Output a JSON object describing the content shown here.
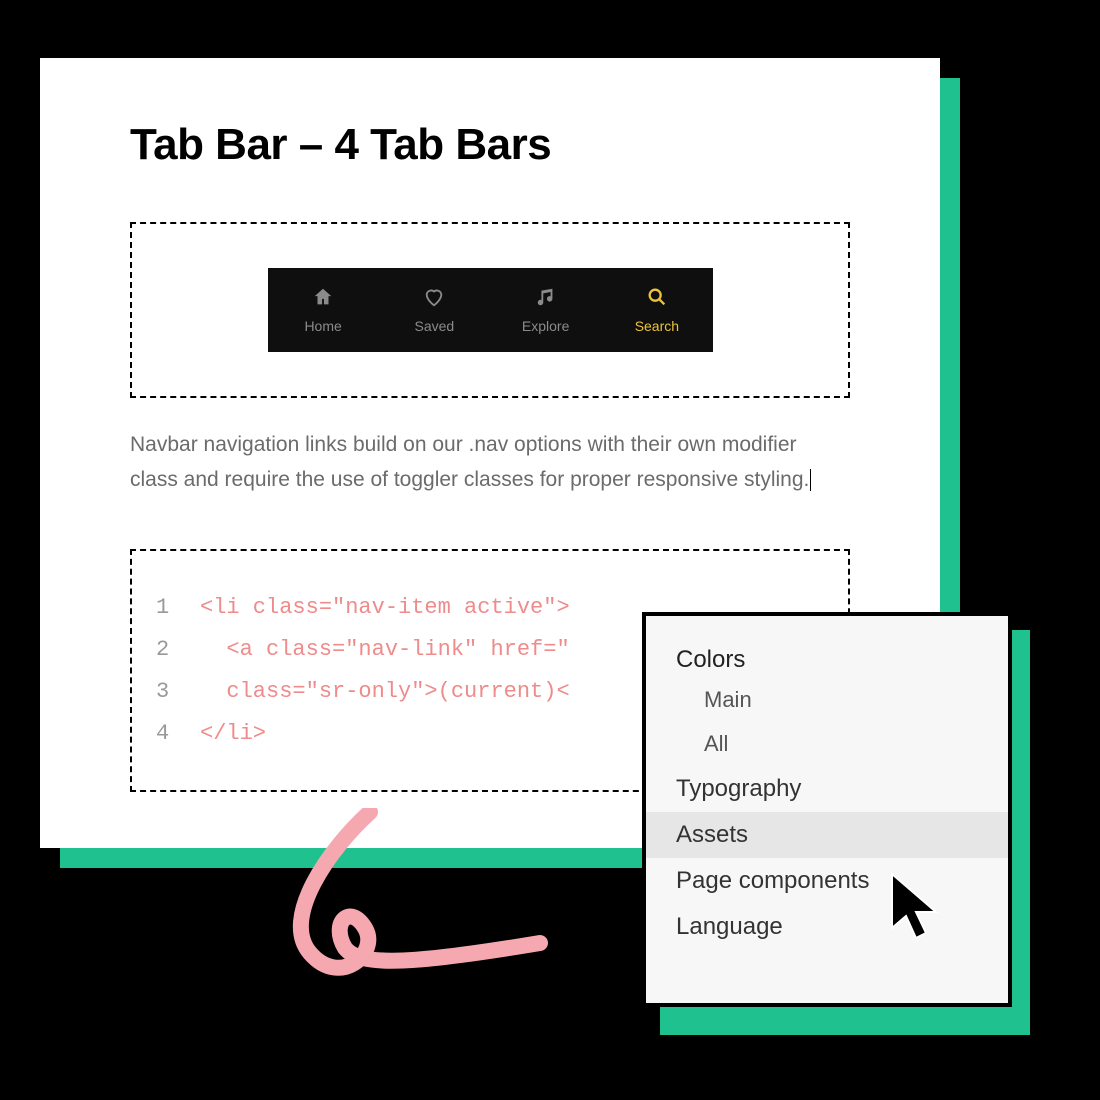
{
  "title": "Tab Bar – 4 Tab Bars",
  "tabs": [
    {
      "label": "Home",
      "icon": "home-icon",
      "active": false
    },
    {
      "label": "Saved",
      "icon": "heart-icon",
      "active": false
    },
    {
      "label": "Explore",
      "icon": "music-icon",
      "active": false
    },
    {
      "label": "Search",
      "icon": "search-icon",
      "active": true
    }
  ],
  "description": "Navbar navigation links build on our .nav options with their own modifier class and require the use of toggler classes for proper responsive styling.",
  "code": {
    "lines": [
      {
        "num": "1",
        "text": "<li class=\"nav-item active\">"
      },
      {
        "num": "2",
        "text": "  <a class=\"nav-link\" href=\""
      },
      {
        "num": "3",
        "text": "  class=\"sr-only\">(current)<"
      },
      {
        "num": "4",
        "text": "</li>"
      }
    ]
  },
  "menu": {
    "heading": "Colors",
    "subs": [
      "Main",
      "All"
    ],
    "items": [
      {
        "label": "Typography",
        "hovered": false
      },
      {
        "label": "Assets",
        "hovered": true
      },
      {
        "label": "Page components",
        "hovered": false
      },
      {
        "label": "Language",
        "hovered": false
      }
    ]
  }
}
